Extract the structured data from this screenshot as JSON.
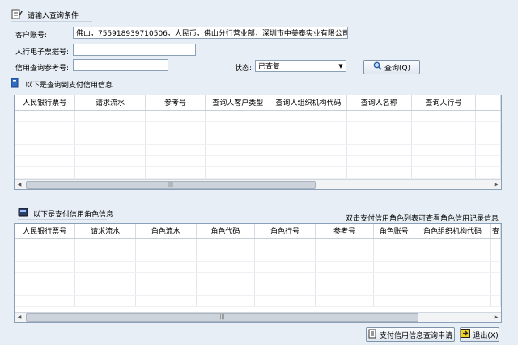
{
  "query": {
    "header": "请输入查询条件",
    "customer_account_label": "客户账号:",
    "customer_account_value": "佛山，755918939710506，人民币，佛山分行营业部，深圳市中美泰实业有限公司",
    "pboc_ticket_label": "人行电子票据号:",
    "pboc_ticket_value": "",
    "credit_ref_label": "信用查询参考号:",
    "credit_ref_value": "",
    "status_label": "状态:",
    "status_value": "已查复",
    "query_button": "查询(Q)"
  },
  "upper": {
    "title": "以下是查询到支付信用信息",
    "columns": [
      "人民银行票号",
      "请求流水",
      "参考号",
      "查询人客户类型",
      "查询人组织机构代码",
      "查询人名称",
      "查询人行号"
    ]
  },
  "lower": {
    "title": "以下是支付信用角色信息",
    "hint": "双击支付信用角色列表可查看角色信用记录信息",
    "columns": [
      "人民银行票号",
      "请求流水",
      "角色流水",
      "角色代码",
      "角色行号",
      "参考号",
      "角色账号",
      "角色组织机构代码",
      "查"
    ]
  },
  "footer": {
    "apply_button": "支付信用信息查询申请",
    "exit_button": "退出(X)"
  },
  "icons": {
    "query_header": "edit-form-icon",
    "upper_title": "book-icon",
    "lower_title": "card-icon",
    "query_button": "magnifier-icon",
    "apply_button": "document-icon",
    "exit_button": "exit-icon"
  }
}
